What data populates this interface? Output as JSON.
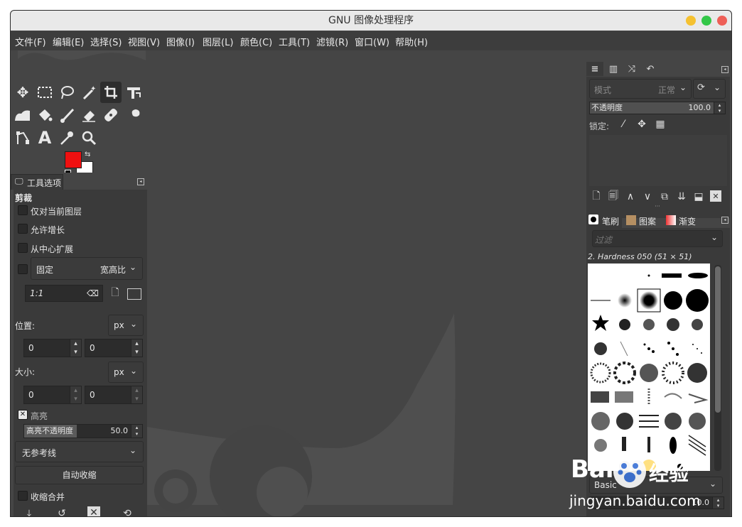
{
  "window": {
    "title": "GNU 图像处理程序"
  },
  "colors": {
    "close": "#ee5f57",
    "minimize": "#f5c130",
    "maximize": "#33c748",
    "fg": "#f01010",
    "bg": "#ffffff"
  },
  "menubar": [
    "文件(F)",
    "编辑(E)",
    "选择(S)",
    "视图(V)",
    "图像(I)",
    "图层(L)",
    "颜色(C)",
    "工具(T)",
    "滤镜(R)",
    "窗口(W)",
    "帮助(H)"
  ],
  "tool_options": {
    "tab_label": "工具选项",
    "tool_name": "剪裁",
    "current_layer_only": "仅对当前图层",
    "allow_growing": "允许增长",
    "expand_from_center": "从中心扩展",
    "fixed": "固定",
    "fixed_mode": "宽高比",
    "ratio_value": "1:1",
    "position_label": "位置:",
    "position_unit": "px",
    "position_x": "0",
    "position_y": "0",
    "size_label": "大小:",
    "size_unit": "px",
    "size_w": "0",
    "size_h": "0",
    "highlight": "高亮",
    "highlight_opacity_label": "高亮不透明度",
    "highlight_opacity_value": "50.0",
    "guides": "无参考线",
    "auto_shrink": "自动收缩",
    "shrink_merged": "收缩合并"
  },
  "layers": {
    "mode_placeholder": "模式",
    "mode_value": "正常",
    "opacity_label": "不透明度",
    "opacity_value": "100.0",
    "lock_label": "锁定:"
  },
  "brushes": {
    "tab_brushes": "笔刷",
    "tab_patterns": "图案",
    "tab_gradients": "渐变",
    "filter_placeholder": "过滤",
    "selected_brush": "2. Hardness 050 (51 × 51)",
    "preset": "Basic",
    "spacing_value": "10.0"
  },
  "watermark": {
    "brand": "Bai",
    "brand_cn": "经验",
    "url": "jingyan.baidu.com"
  }
}
